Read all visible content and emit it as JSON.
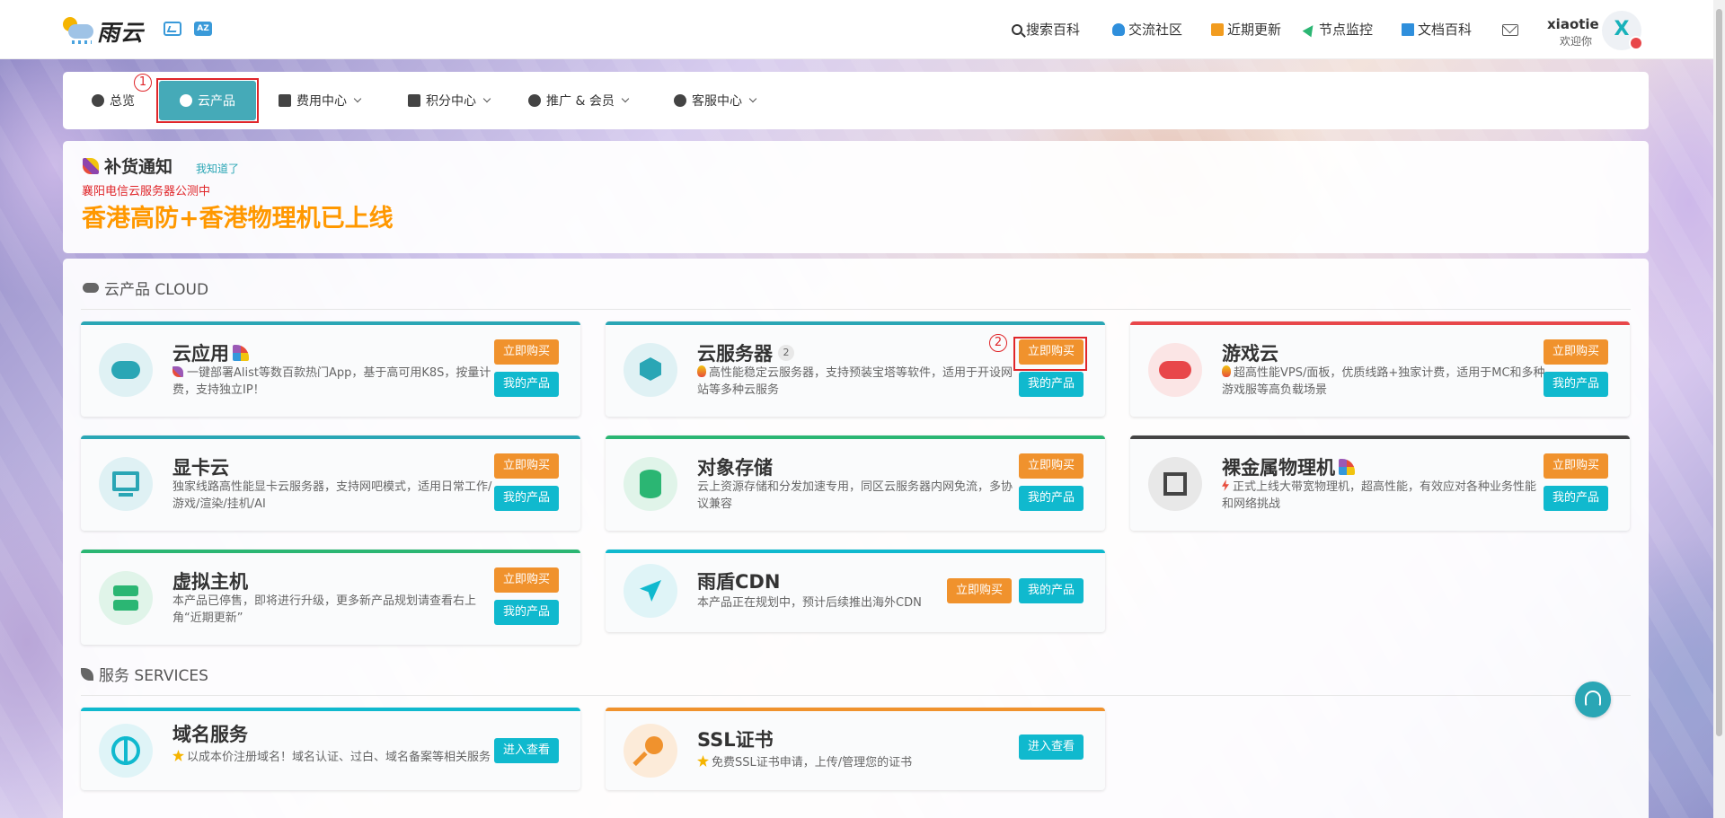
{
  "header": {
    "logo_text": "雨云",
    "nav": [
      "搜索百科",
      "交流社区",
      "近期更新",
      "节点监控",
      "文档百科"
    ],
    "user_name": "xiaotie",
    "user_sub": "欢迎你",
    "avatar_letter": "X"
  },
  "mainnav": {
    "overview": "总览",
    "cloud_products": "云产品",
    "billing": "费用中心",
    "points": "积分中心",
    "promo": "推广 & 会员",
    "support": "客服中心"
  },
  "annotations": {
    "one": "1",
    "two": "2"
  },
  "notice": {
    "title": "补货通知",
    "ok": "我知道了",
    "sub": "襄阳电信云服务器公测中",
    "main": "香港高防+香港物理机已上线"
  },
  "sections": {
    "cloud": "云产品 CLOUD",
    "services": "服务 SERVICES"
  },
  "buttons": {
    "buy": "立即购买",
    "mine": "我的产品",
    "enter": "进入查看"
  },
  "products": [
    {
      "title": "云应用",
      "desc": "一键部署Alist等数百款热门App，基于高可用K8S，按量计费，支持独立IP！",
      "accent": "#2aa6b5"
    },
    {
      "title": "云服务器",
      "badge": "2",
      "desc": "高性能稳定云服务器，支持预装宝塔等软件，适用于开设网站等多种云服务",
      "accent": "#2aa6b5"
    },
    {
      "title": "游戏云",
      "desc": "超高性能VPS/面板，优质线路+独家计费，适用于MC和多种游戏服等高负载场景",
      "accent": "#e8474a"
    },
    {
      "title": "显卡云",
      "desc": "独家线路高性能显卡云服务器，支持网吧模式，适用日常工作/游戏/渲染/挂机/AI",
      "accent": "#2aa6b5"
    },
    {
      "title": "对象存储",
      "desc": "云上资源存储和分发加速专用，同区云服务器内网免流，多协议兼容",
      "accent": "#2bb673"
    },
    {
      "title": "裸金属物理机",
      "desc": "正式上线大带宽物理机，超高性能，有效应对各种业务性能和网络挑战",
      "accent": "#444444"
    },
    {
      "title": "虚拟主机",
      "desc": "本产品已停售，即将进行升级，更多新产品规划请查看右上角“近期更新”",
      "accent": "#2bb673"
    },
    {
      "title": "雨盾CDN",
      "desc": "本产品正在规划中，预计后续推出海外CDN",
      "accent": "#10b9ce"
    }
  ],
  "services": [
    {
      "title": "域名服务",
      "desc": "以成本价注册域名！域名认证、过白、域名备案等相关服务",
      "accent": "#10b9ce"
    },
    {
      "title": "SSL证书",
      "desc": "免费SSL证书申请，上传/管理您的证书",
      "accent": "#f0922d"
    }
  ]
}
